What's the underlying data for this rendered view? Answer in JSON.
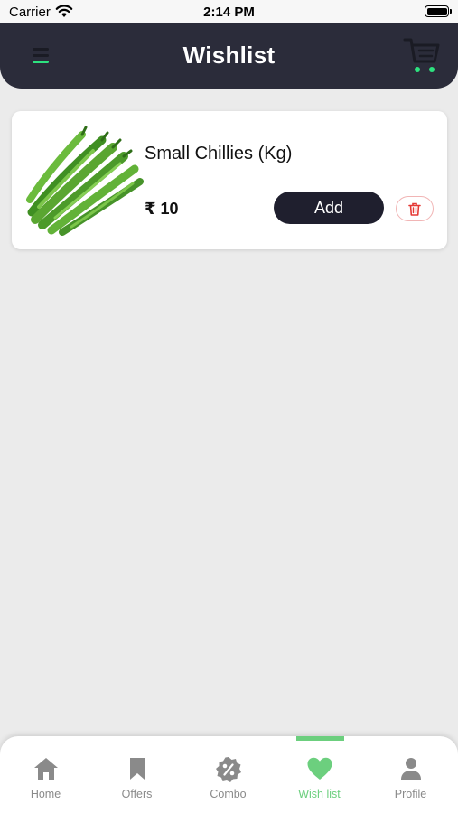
{
  "status_bar": {
    "carrier": "Carrier",
    "time": "2:14 PM"
  },
  "header": {
    "title": "Wishlist",
    "accent_color": "#2de27f",
    "background": "#2b2c3a"
  },
  "wishlist": {
    "items": [
      {
        "name": "Small Chillies (Kg)",
        "price": "₹ 10",
        "add_label": "Add",
        "image_icon": "green-chillies-image"
      }
    ]
  },
  "bottom_nav": {
    "active_color": "#6ccf7e",
    "inactive_color": "#8a8a8a",
    "items": [
      {
        "label": "Home",
        "icon": "home-icon"
      },
      {
        "label": "Offers",
        "icon": "bookmark-icon"
      },
      {
        "label": "Combo",
        "icon": "percent-badge-icon"
      },
      {
        "label": "Wish list",
        "icon": "heart-icon",
        "active": true
      },
      {
        "label": "Profile",
        "icon": "person-icon"
      }
    ]
  }
}
